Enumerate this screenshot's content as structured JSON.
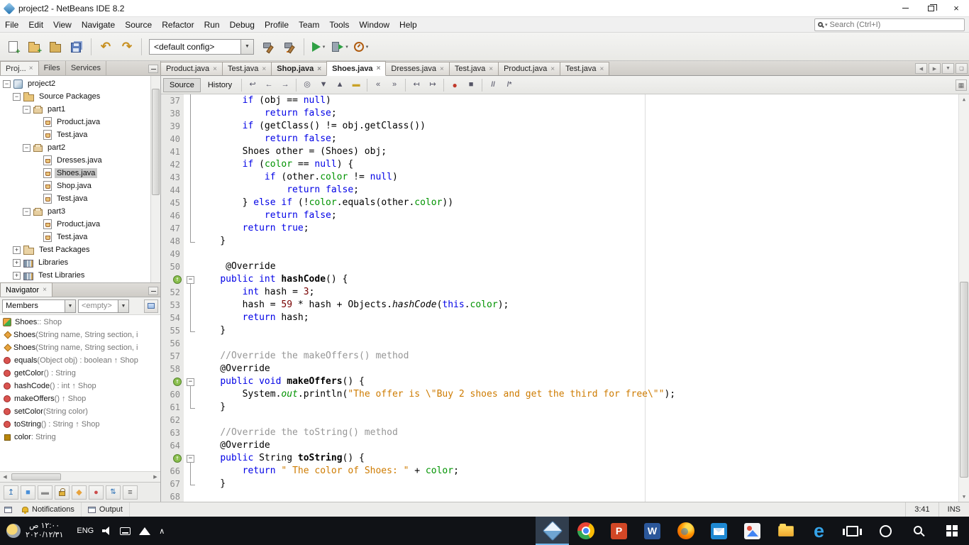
{
  "window": {
    "title": "project2 - NetBeans IDE 8.2"
  },
  "menubar": {
    "items": [
      "File",
      "Edit",
      "View",
      "Navigate",
      "Source",
      "Refactor",
      "Run",
      "Debug",
      "Profile",
      "Team",
      "Tools",
      "Window",
      "Help"
    ],
    "search_placeholder": "Search (Ctrl+I)"
  },
  "main_toolbar": {
    "config": "<default config>",
    "buttons_left": [
      "new-file",
      "new-project",
      "open-project",
      "save-all",
      "|",
      "undo",
      "redo"
    ],
    "buttons_right": [
      "build",
      "clean-build",
      "|",
      "run",
      "debug",
      "profile"
    ],
    "dropdowns": [
      "run",
      "debug",
      "profile"
    ]
  },
  "left": {
    "tabs": [
      {
        "label": "Proj...",
        "active": true
      },
      {
        "label": "Files"
      },
      {
        "label": "Services"
      }
    ],
    "tree": [
      {
        "depth": 0,
        "expander": "minus",
        "icon": "project",
        "label": "project2"
      },
      {
        "depth": 1,
        "expander": "minus",
        "icon": "srcfolder",
        "label": "Source Packages"
      },
      {
        "depth": 2,
        "expander": "minus",
        "icon": "package",
        "label": "part1"
      },
      {
        "depth": 3,
        "expander": "",
        "icon": "java",
        "label": "Product.java"
      },
      {
        "depth": 3,
        "expander": "",
        "icon": "java",
        "label": "Test.java"
      },
      {
        "depth": 2,
        "expander": "minus",
        "icon": "package",
        "label": "part2"
      },
      {
        "depth": 3,
        "expander": "",
        "icon": "java",
        "label": "Dresses.java"
      },
      {
        "depth": 3,
        "expander": "",
        "icon": "java",
        "label": "Shoes.java",
        "selected": true
      },
      {
        "depth": 3,
        "expander": "",
        "icon": "java",
        "label": "Shop.java"
      },
      {
        "depth": 3,
        "expander": "",
        "icon": "java",
        "label": "Test.java"
      },
      {
        "depth": 2,
        "expander": "minus",
        "icon": "package",
        "label": "part3"
      },
      {
        "depth": 3,
        "expander": "",
        "icon": "java",
        "label": "Product.java"
      },
      {
        "depth": 3,
        "expander": "",
        "icon": "java",
        "label": "Test.java"
      },
      {
        "depth": 1,
        "expander": "plus",
        "icon": "folder",
        "label": "Test Packages"
      },
      {
        "depth": 1,
        "expander": "plus",
        "icon": "libs",
        "label": "Libraries"
      },
      {
        "depth": 1,
        "expander": "plus",
        "icon": "libs",
        "label": "Test Libraries"
      }
    ],
    "navigator": {
      "title": "Navigator",
      "members_filter": "Members",
      "scope_filter": "<empty>",
      "items": [
        {
          "icon": "class",
          "parts": [
            [
              "b",
              "Shoes"
            ],
            [
              "g",
              " :: Shop"
            ]
          ]
        },
        {
          "icon": "ctor",
          "parts": [
            [
              "b",
              "Shoes"
            ],
            [
              "g",
              "(String name, String section, i"
            ]
          ]
        },
        {
          "icon": "ctor",
          "parts": [
            [
              "b",
              "Shoes"
            ],
            [
              "g",
              "(String name, String section, i"
            ]
          ]
        },
        {
          "icon": "method",
          "parts": [
            [
              "b",
              "equals"
            ],
            [
              "g",
              "(Object obj) : boolean ↑ Shop"
            ]
          ]
        },
        {
          "icon": "method",
          "parts": [
            [
              "b",
              "getColor"
            ],
            [
              "g",
              "() : String"
            ]
          ]
        },
        {
          "icon": "method",
          "parts": [
            [
              "b",
              "hashCode"
            ],
            [
              "g",
              "() : int ↑ Shop"
            ]
          ]
        },
        {
          "icon": "method",
          "parts": [
            [
              "b",
              "makeOffers"
            ],
            [
              "g",
              "() ↑ Shop"
            ]
          ]
        },
        {
          "icon": "method",
          "parts": [
            [
              "b",
              "setColor"
            ],
            [
              "g",
              "(String color)"
            ]
          ]
        },
        {
          "icon": "method",
          "parts": [
            [
              "b",
              "toString"
            ],
            [
              "g",
              "() : String ↑ Shop"
            ]
          ]
        },
        {
          "icon": "field",
          "parts": [
            [
              "b",
              "color"
            ],
            [
              "g",
              " : String"
            ]
          ]
        }
      ],
      "bottom_buttons": [
        "show-inherited",
        "show-fields",
        "show-static",
        "show-non-public",
        "sort-by-name",
        "sort-by-source",
        "expand-all",
        "collapse-all"
      ]
    }
  },
  "editor": {
    "tabs": [
      {
        "label": "Product.java"
      },
      {
        "label": "Test.java"
      },
      {
        "label": "Shop.java",
        "bold": true
      },
      {
        "label": "Shoes.java",
        "active": true,
        "bold": true
      },
      {
        "label": "Dresses.java"
      },
      {
        "label": "Test.java"
      },
      {
        "label": "Product.java"
      },
      {
        "label": "Test.java"
      }
    ],
    "toolbar": {
      "source_label": "Source",
      "history_label": "History",
      "icons": [
        "last-edit",
        "back",
        "forward",
        "|",
        "find-selection",
        "find-next",
        "find-previous",
        "toggle-highlight",
        "|",
        "previous-bookmark",
        "next-bookmark",
        "|",
        "shift-left",
        "shift-right",
        "|",
        "macro-start",
        "macro-stop",
        "|",
        "comment",
        "uncomment"
      ]
    },
    "code": {
      "lines": [
        {
          "n": 37,
          "f": "l",
          "t": [
            [
              "pl",
              "        "
            ],
            [
              "kw",
              "if"
            ],
            [
              "pl",
              " (obj == "
            ],
            [
              "kw",
              "null"
            ],
            [
              "pl",
              ")"
            ]
          ]
        },
        {
          "n": 38,
          "f": "l",
          "t": [
            [
              "pl",
              "            "
            ],
            [
              "kw",
              "return"
            ],
            [
              "pl",
              " "
            ],
            [
              "kw",
              "false"
            ],
            [
              "pl",
              ";"
            ]
          ]
        },
        {
          "n": 39,
          "f": "l",
          "t": [
            [
              "pl",
              "        "
            ],
            [
              "kw",
              "if"
            ],
            [
              "pl",
              " (getClass() != obj.getClass())"
            ]
          ]
        },
        {
          "n": 40,
          "f": "l",
          "t": [
            [
              "pl",
              "            "
            ],
            [
              "kw",
              "return"
            ],
            [
              "pl",
              " "
            ],
            [
              "kw",
              "false"
            ],
            [
              "pl",
              ";"
            ]
          ]
        },
        {
          "n": 41,
          "f": "l",
          "t": [
            [
              "pl",
              "        Shoes other = (Shoes) obj;"
            ]
          ]
        },
        {
          "n": 42,
          "f": "l",
          "t": [
            [
              "pl",
              "        "
            ],
            [
              "kw",
              "if"
            ],
            [
              "pl",
              " ("
            ],
            [
              "fd",
              "color"
            ],
            [
              "pl",
              " == "
            ],
            [
              "kw",
              "null"
            ],
            [
              "pl",
              ") {"
            ]
          ]
        },
        {
          "n": 43,
          "f": "l",
          "t": [
            [
              "pl",
              "            "
            ],
            [
              "kw",
              "if"
            ],
            [
              "pl",
              " (other."
            ],
            [
              "fd",
              "color"
            ],
            [
              "pl",
              " != "
            ],
            [
              "kw",
              "null"
            ],
            [
              "pl",
              ")"
            ]
          ]
        },
        {
          "n": 44,
          "f": "l",
          "t": [
            [
              "pl",
              "                "
            ],
            [
              "kw",
              "return"
            ],
            [
              "pl",
              " "
            ],
            [
              "kw",
              "false"
            ],
            [
              "pl",
              ";"
            ]
          ]
        },
        {
          "n": 45,
          "f": "l",
          "t": [
            [
              "pl",
              "        } "
            ],
            [
              "kw",
              "else"
            ],
            [
              "pl",
              " "
            ],
            [
              "kw",
              "if"
            ],
            [
              "pl",
              " (!"
            ],
            [
              "fd",
              "color"
            ],
            [
              "pl",
              ".equals(other."
            ],
            [
              "fd",
              "color"
            ],
            [
              "pl",
              "))"
            ]
          ]
        },
        {
          "n": 46,
          "f": "l",
          "t": [
            [
              "pl",
              "            "
            ],
            [
              "kw",
              "return"
            ],
            [
              "pl",
              " "
            ],
            [
              "kw",
              "false"
            ],
            [
              "pl",
              ";"
            ]
          ]
        },
        {
          "n": 47,
          "f": "l",
          "t": [
            [
              "pl",
              "        "
            ],
            [
              "kw",
              "return"
            ],
            [
              "pl",
              " "
            ],
            [
              "kw",
              "true"
            ],
            [
              "pl",
              ";"
            ]
          ]
        },
        {
          "n": 48,
          "f": "e",
          "t": [
            [
              "pl",
              "    }"
            ]
          ]
        },
        {
          "n": 49,
          "f": "",
          "t": []
        },
        {
          "n": 50,
          "f": "",
          "t": [
            [
              "pl",
              "     @Override"
            ]
          ]
        },
        {
          "n": 51,
          "f": "b",
          "g": true,
          "t": [
            [
              "pl",
              "    "
            ],
            [
              "kw",
              "public"
            ],
            [
              "pl",
              " "
            ],
            [
              "kw",
              "int"
            ],
            [
              "pl",
              " "
            ],
            [
              "md",
              "hashCode"
            ],
            [
              "pl",
              "() {"
            ]
          ]
        },
        {
          "n": 52,
          "f": "l",
          "t": [
            [
              "pl",
              "        "
            ],
            [
              "kw",
              "int"
            ],
            [
              "pl",
              " hash = "
            ],
            [
              "nm",
              "3"
            ],
            [
              "pl",
              ";"
            ]
          ]
        },
        {
          "n": 53,
          "f": "l",
          "t": [
            [
              "pl",
              "        hash = "
            ],
            [
              "nm",
              "59"
            ],
            [
              "pl",
              " * hash + Objects."
            ],
            [
              "it",
              "hashCode"
            ],
            [
              "pl",
              "("
            ],
            [
              "kw",
              "this"
            ],
            [
              "pl",
              "."
            ],
            [
              "fd",
              "color"
            ],
            [
              "pl",
              ");"
            ]
          ]
        },
        {
          "n": 54,
          "f": "l",
          "t": [
            [
              "pl",
              "        "
            ],
            [
              "kw",
              "return"
            ],
            [
              "pl",
              " hash;"
            ]
          ]
        },
        {
          "n": 55,
          "f": "e",
          "t": [
            [
              "pl",
              "    }"
            ]
          ]
        },
        {
          "n": 56,
          "f": "",
          "t": []
        },
        {
          "n": 57,
          "f": "",
          "t": [
            [
              "pl",
              "    "
            ],
            [
              "cm",
              "//Override the makeOffers() method"
            ]
          ]
        },
        {
          "n": 58,
          "f": "",
          "t": [
            [
              "pl",
              "    @Override"
            ]
          ]
        },
        {
          "n": 59,
          "f": "b",
          "g": true,
          "t": [
            [
              "pl",
              "    "
            ],
            [
              "kw",
              "public"
            ],
            [
              "pl",
              " "
            ],
            [
              "kw",
              "void"
            ],
            [
              "pl",
              " "
            ],
            [
              "md",
              "makeOffers"
            ],
            [
              "pl",
              "() {"
            ]
          ]
        },
        {
          "n": 60,
          "f": "l",
          "t": [
            [
              "pl",
              "        System."
            ],
            [
              "gi",
              "out"
            ],
            [
              "pl",
              ".println("
            ],
            [
              "st",
              "\"The offer is \\\"Buy 2 shoes and get the third for free\\\"\""
            ],
            [
              "pl",
              ");"
            ]
          ]
        },
        {
          "n": 61,
          "f": "e",
          "t": [
            [
              "pl",
              "    }"
            ]
          ]
        },
        {
          "n": 62,
          "f": "",
          "t": []
        },
        {
          "n": 63,
          "f": "",
          "t": [
            [
              "pl",
              "    "
            ],
            [
              "cm",
              "//Override the toString() method"
            ]
          ]
        },
        {
          "n": 64,
          "f": "",
          "t": [
            [
              "pl",
              "    @Override"
            ]
          ]
        },
        {
          "n": 65,
          "f": "b",
          "g": true,
          "t": [
            [
              "pl",
              "    "
            ],
            [
              "kw",
              "public"
            ],
            [
              "pl",
              " String "
            ],
            [
              "md",
              "toString"
            ],
            [
              "pl",
              "() {"
            ]
          ]
        },
        {
          "n": 66,
          "f": "l",
          "t": [
            [
              "pl",
              "        "
            ],
            [
              "kw",
              "return"
            ],
            [
              "pl",
              " "
            ],
            [
              "st",
              "\" The color of Shoes: \""
            ],
            [
              "pl",
              " + "
            ],
            [
              "fd",
              "color"
            ],
            [
              "pl",
              ";"
            ]
          ]
        },
        {
          "n": 67,
          "f": "e",
          "t": [
            [
              "pl",
              "    }"
            ]
          ]
        },
        {
          "n": 68,
          "f": "",
          "t": []
        }
      ]
    }
  },
  "statusbar": {
    "notifications": "Notifications",
    "output": "Output",
    "caret": "3:41",
    "insert_mode": "INS"
  },
  "taskbar": {
    "clock_time": "١٢:٠٠ ص",
    "clock_date": "٢٠٢٠/١٢/٣١",
    "language": "ENG",
    "apps": [
      {
        "name": "netbeans",
        "active": true
      },
      {
        "name": "chrome"
      },
      {
        "name": "powerpoint",
        "letter": "P"
      },
      {
        "name": "word",
        "letter": "W"
      },
      {
        "name": "firefox"
      },
      {
        "name": "mail"
      },
      {
        "name": "photos"
      },
      {
        "name": "explorer"
      },
      {
        "name": "edge",
        "letter": "e"
      },
      {
        "name": "task-view"
      },
      {
        "name": "cortana"
      },
      {
        "name": "search"
      },
      {
        "name": "start"
      }
    ]
  }
}
